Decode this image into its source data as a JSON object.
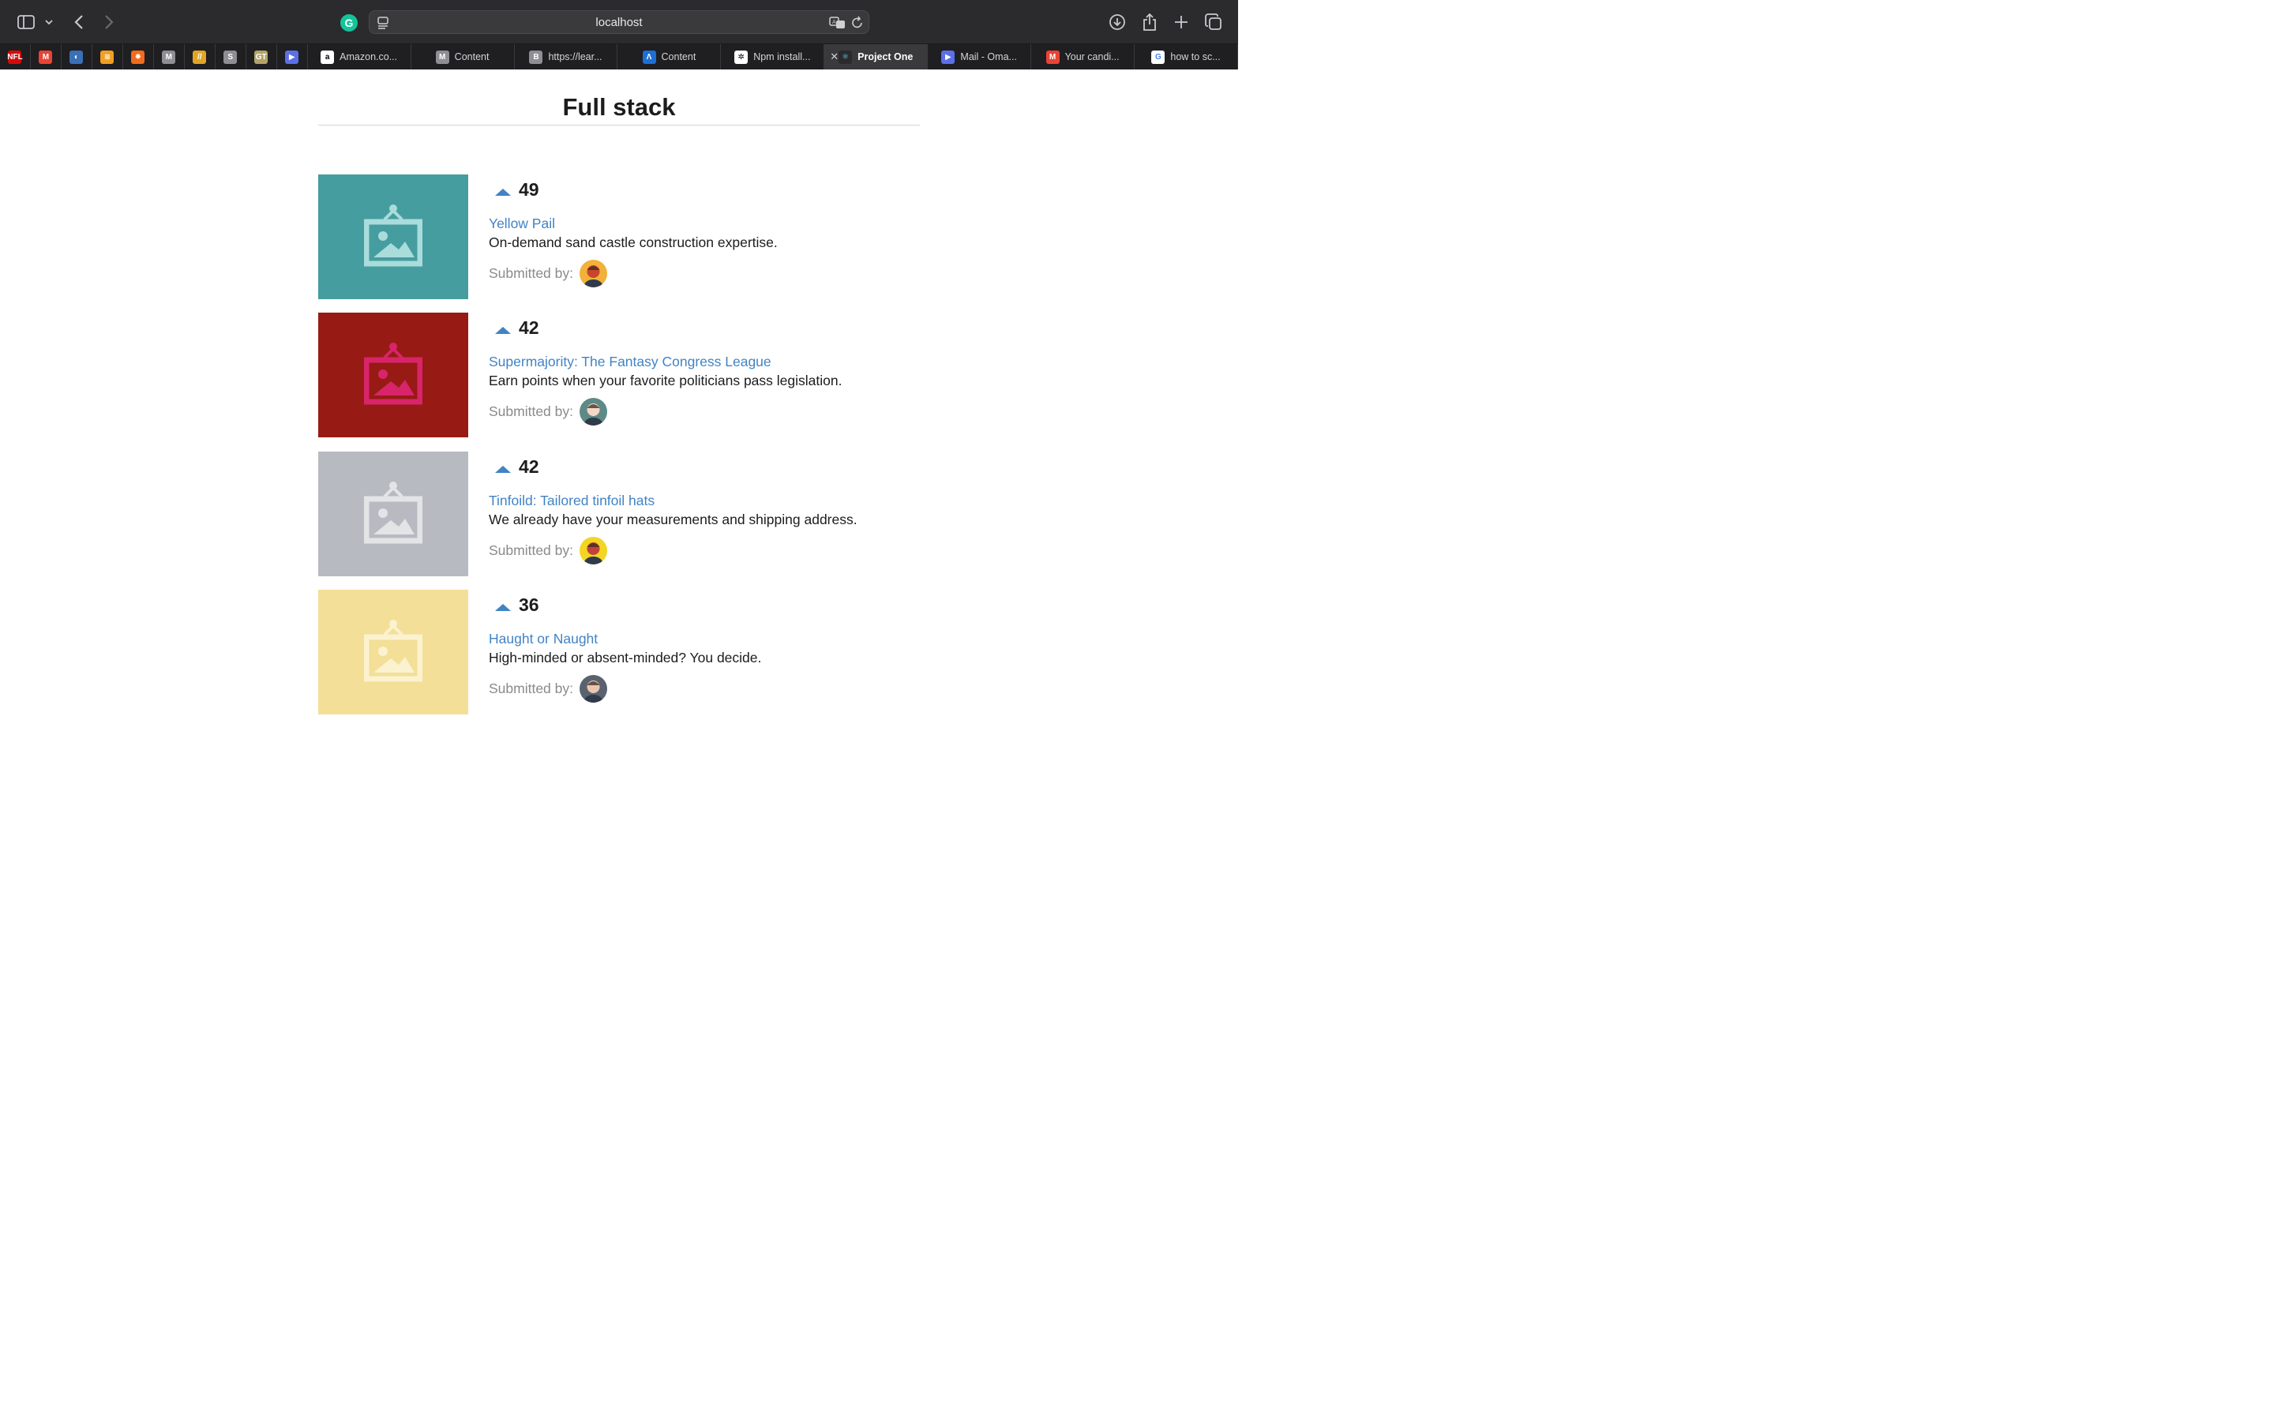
{
  "browser": {
    "url": "localhost",
    "pinned_tabs": [
      {
        "icon": "nfl-icon",
        "glyph": "NFL",
        "color": "#d50a0a"
      },
      {
        "icon": "gmail-icon",
        "glyph": "M",
        "color": "#ea4335"
      },
      {
        "icon": "app-icon",
        "glyph": "◐",
        "color": "#3b6fb6"
      },
      {
        "icon": "wave-icon",
        "glyph": "≋",
        "color": "#f0a020"
      },
      {
        "icon": "sun-icon",
        "glyph": "✹",
        "color": "#f26b1d"
      },
      {
        "icon": "m-icon",
        "glyph": "M",
        "color": "#8e8e93"
      },
      {
        "icon": "stripes-icon",
        "glyph": "//",
        "color": "#e0a526"
      },
      {
        "icon": "s-icon",
        "glyph": "S",
        "color": "#8e8e93"
      },
      {
        "icon": "gt-icon",
        "glyph": "GT",
        "color": "#b3a369"
      },
      {
        "icon": "play-icon",
        "glyph": "▶",
        "color": "#5b6fe6"
      }
    ],
    "tabs": [
      {
        "label": "Amazon.co...",
        "icon": "amazon-icon",
        "glyph": "a",
        "color": "#ffffff",
        "fg": "#000000"
      },
      {
        "label": "Content",
        "icon": "m-icon",
        "glyph": "M",
        "color": "#8e8e93",
        "fg": "#ffffff"
      },
      {
        "label": "https://lear...",
        "icon": "b-icon",
        "glyph": "B",
        "color": "#8e8e93",
        "fg": "#ffffff"
      },
      {
        "label": "Content",
        "icon": "lambda-icon",
        "glyph": "Λ",
        "color": "#1d6fd6",
        "fg": "#ffffff"
      },
      {
        "label": "Npm install...",
        "icon": "openai-icon",
        "glyph": "✲",
        "color": "#ffffff",
        "fg": "#000000"
      },
      {
        "label": "Project One",
        "icon": "react-icon",
        "glyph": "⚛",
        "color": "#2b2a2d",
        "fg": "#61dafb",
        "active": true
      },
      {
        "label": "Mail - Oma...",
        "icon": "play-icon",
        "glyph": "▶",
        "color": "#5b6fe6",
        "fg": "#ffffff"
      },
      {
        "label": "Your candi...",
        "icon": "gmail-icon",
        "glyph": "M",
        "color": "#ea4335",
        "fg": "#ffffff"
      },
      {
        "label": "how to sc...",
        "icon": "google-icon",
        "glyph": "G",
        "color": "#ffffff",
        "fg": "#4285f4"
      }
    ]
  },
  "page": {
    "title": "Full stack",
    "submitted_label": "Submitted by:",
    "link_color": "#4183c4",
    "items": [
      {
        "votes": "49",
        "title": "Yellow Pail",
        "description": "On-demand sand castle construction expertise.",
        "thumb_bg": "#459d9f",
        "thumb_fg": "#a9dcdb",
        "avatar_bg": "#f2b13a",
        "avatar_fg": "#c8442c"
      },
      {
        "votes": "42",
        "title": "Supermajority: The Fantasy Congress League",
        "description": "Earn points when your favorite politicians pass legislation.",
        "thumb_bg": "#971a14",
        "thumb_fg": "#d8246a",
        "avatar_bg": "#5d8a86",
        "avatar_fg": "#f4d7c4"
      },
      {
        "votes": "42",
        "title": "Tinfoild: Tailored tinfoil hats",
        "description": "We already have your measurements and shipping address.",
        "thumb_bg": "#b7bbc1",
        "thumb_fg": "#e3e4e6",
        "avatar_bg": "#f3d522",
        "avatar_fg": "#c2413a"
      },
      {
        "votes": "36",
        "title": "Haught or Naught",
        "description": "High-minded or absent-minded? You decide.",
        "thumb_bg": "#f3df97",
        "thumb_fg": "#fbf2cf",
        "avatar_bg": "#5a6270",
        "avatar_fg": "#e9c6b0"
      }
    ]
  }
}
